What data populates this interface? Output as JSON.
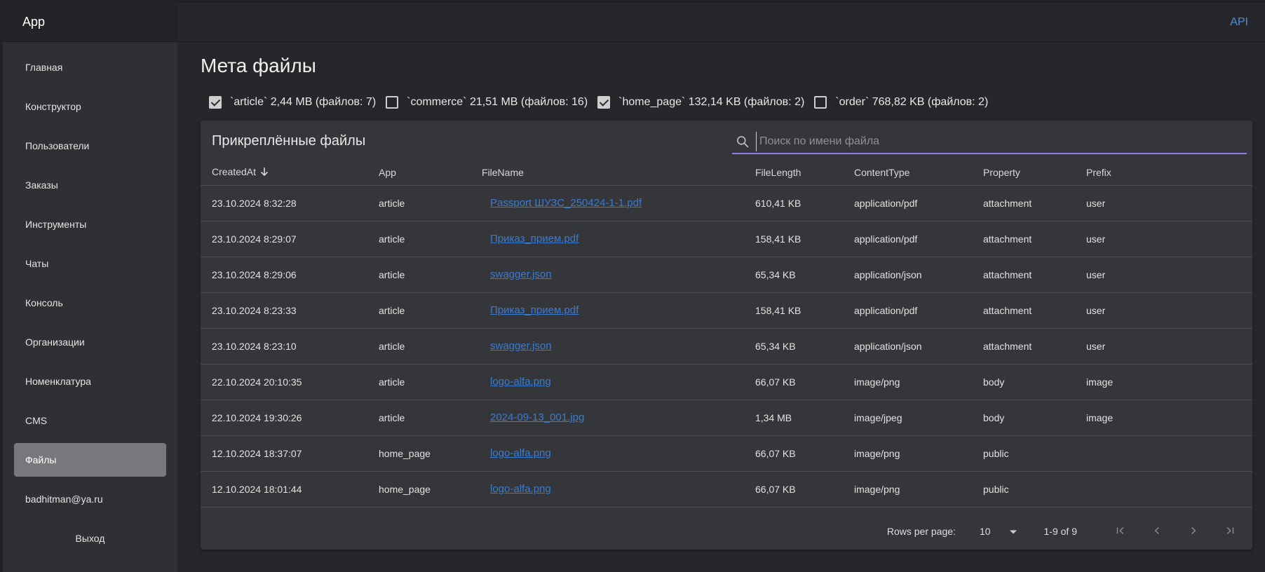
{
  "app": {
    "title": "App",
    "api_link": "API"
  },
  "sidebar": {
    "items": [
      {
        "label": "Главная"
      },
      {
        "label": "Конструктор"
      },
      {
        "label": "Пользователи"
      },
      {
        "label": "Заказы"
      },
      {
        "label": "Инструменты"
      },
      {
        "label": "Чаты"
      },
      {
        "label": "Консоль"
      },
      {
        "label": "Организации"
      },
      {
        "label": "Номенклатура"
      },
      {
        "label": "CMS"
      },
      {
        "label": "Файлы",
        "active": true
      }
    ],
    "user_email": "badhitman@ya.ru",
    "logout_label": "Выход"
  },
  "page": {
    "title": "Мета файлы"
  },
  "filters": [
    {
      "label": "`article` 2,44 MB (файлов: 7)",
      "checked": true
    },
    {
      "label": "`commerce` 21,51 MB (файлов: 16)",
      "checked": false
    },
    {
      "label": "`home_page` 132,14 KB (файлов: 2)",
      "checked": true
    },
    {
      "label": "`order` 768,82 KB (файлов: 2)",
      "checked": false
    }
  ],
  "card": {
    "title": "Прикреплённые файлы",
    "search_placeholder": "Поиск по имени файла"
  },
  "table": {
    "columns": [
      "CreatedAt",
      "App",
      "FileName",
      "FileLength",
      "ContentType",
      "Property",
      "Prefix"
    ],
    "sort_column": "CreatedAt",
    "sort_direction": "desc",
    "rows": [
      [
        "23.10.2024 8:32:28",
        "article",
        "Passport ШУЗС_250424-1-1.pdf",
        "610,41 KB",
        "application/pdf",
        "attachment",
        "user"
      ],
      [
        "23.10.2024 8:29:07",
        "article",
        "Приказ_прием.pdf",
        "158,41 KB",
        "application/pdf",
        "attachment",
        "user"
      ],
      [
        "23.10.2024 8:29:06",
        "article",
        "swagger.json",
        "65,34 KB",
        "application/json",
        "attachment",
        "user"
      ],
      [
        "23.10.2024 8:23:33",
        "article",
        "Приказ_прием.pdf",
        "158,41 KB",
        "application/pdf",
        "attachment",
        "user"
      ],
      [
        "23.10.2024 8:23:10",
        "article",
        "swagger.json",
        "65,34 KB",
        "application/json",
        "attachment",
        "user"
      ],
      [
        "22.10.2024 20:10:35",
        "article",
        "logo-alfa.png",
        "66,07 KB",
        "image/png",
        "body",
        "image"
      ],
      [
        "22.10.2024 19:30:26",
        "article",
        "2024-09-13_001.jpg",
        "1,34 MB",
        "image/jpeg",
        "body",
        "image"
      ],
      [
        "12.10.2024 18:37:07",
        "home_page",
        "logo-alfa.png",
        "66,07 KB",
        "image/png",
        "public",
        ""
      ],
      [
        "12.10.2024 18:01:44",
        "home_page",
        "logo-alfa.png",
        "66,07 KB",
        "image/png",
        "public",
        ""
      ]
    ]
  },
  "pagination": {
    "rows_per_page_label": "Rows per page:",
    "rows_per_page": "10",
    "range": "1-9 of 9"
  },
  "colors": {
    "accent_underline": "#8b7ee8",
    "link": "#3b7bd0",
    "api_link": "#4a8fe0",
    "active_nav": "#76787b"
  },
  "icons": {
    "search": "search-icon",
    "sort": "arrow-down-icon",
    "dropdown": "caret-down-icon",
    "first_page": "first-page-icon",
    "prev_page": "chevron-left-icon",
    "next_page": "chevron-right-icon",
    "last_page": "last-page-icon"
  }
}
